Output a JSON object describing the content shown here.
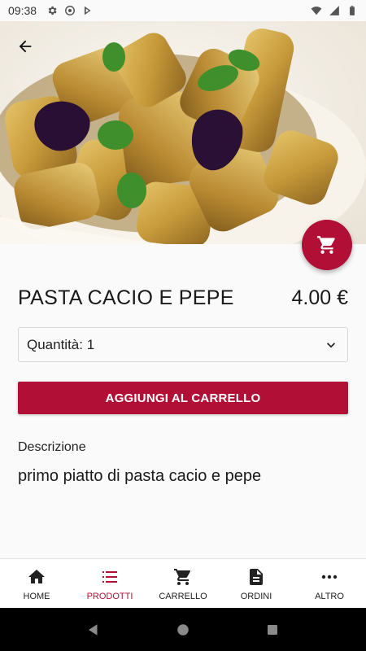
{
  "status_bar": {
    "time": "09:38",
    "icons_left": [
      "gear-icon",
      "at-sign-icon",
      "play-store-icon"
    ],
    "icons_right": [
      "wifi-icon",
      "signal-icon",
      "battery-icon"
    ]
  },
  "hero": {
    "image_subject": "pasta-dish-photo",
    "back_icon": "arrow-back-icon"
  },
  "fab": {
    "icon": "shopping-cart-icon"
  },
  "product": {
    "name": "PASTA CACIO E PEPE",
    "price": "4.00 €"
  },
  "quantity": {
    "selected": "Quantità: 1",
    "icon": "chevron-down-icon"
  },
  "add_button": {
    "label": "AGGIUNGI AL CARRELLO"
  },
  "description": {
    "label": "Descrizione",
    "text": "primo piatto di pasta cacio e pepe"
  },
  "bottom_nav": {
    "items": [
      {
        "label": "HOME",
        "icon": "home-icon",
        "active": false
      },
      {
        "label": "PRODOTTI",
        "icon": "list-icon",
        "active": true
      },
      {
        "label": "CARRELLO",
        "icon": "shopping-cart-icon",
        "active": false
      },
      {
        "label": "ORDINI",
        "icon": "document-icon",
        "active": false
      },
      {
        "label": "ALTRO",
        "icon": "more-horizontal-icon",
        "active": false
      }
    ]
  },
  "colors": {
    "accent": "#b10f35",
    "background": "#fafafa",
    "text": "#1a1a1a"
  }
}
